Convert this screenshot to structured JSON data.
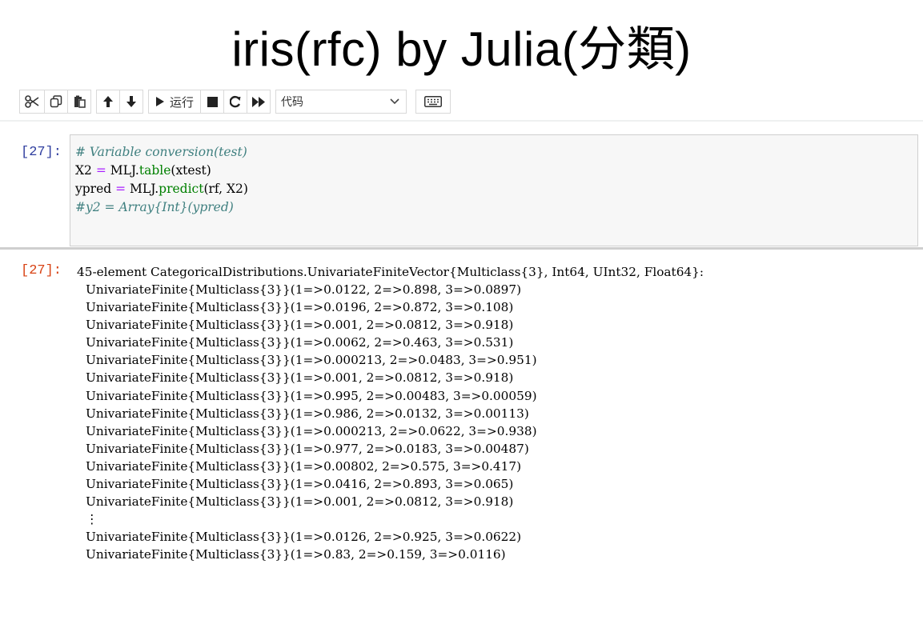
{
  "slide": {
    "title": "iris(rfc) by Julia(分類)"
  },
  "toolbar": {
    "run_label": "运行",
    "cell_type": "代码",
    "icons": [
      "cut-icon",
      "copy-icon",
      "paste-icon",
      "move-up-icon",
      "move-down-icon",
      "run-icon",
      "stop-icon",
      "restart-icon",
      "fast-forward-icon",
      "chevron-down-icon",
      "keyboard-icon"
    ]
  },
  "cell": {
    "in_prompt": "[27]:",
    "out_prompt": "[27]:",
    "code_lines": [
      "# Variable conversion(test)",
      "X2 = MLJ.table(xtest)",
      "ypred = MLJ.predict(rf, X2)",
      "#y2 = Array{Int}(ypred)"
    ]
  },
  "output": {
    "header": "45-element CategoricalDistributions.UnivariateFiniteVector{Multiclass{3}, Int64, UInt32, Float64}:",
    "rows": [
      "UnivariateFinite{Multiclass{3}}(1=>0.0122, 2=>0.898, 3=>0.0897)",
      "UnivariateFinite{Multiclass{3}}(1=>0.0196, 2=>0.872, 3=>0.108)",
      "UnivariateFinite{Multiclass{3}}(1=>0.001, 2=>0.0812, 3=>0.918)",
      "UnivariateFinite{Multiclass{3}}(1=>0.0062, 2=>0.463, 3=>0.531)",
      "UnivariateFinite{Multiclass{3}}(1=>0.000213, 2=>0.0483, 3=>0.951)",
      "UnivariateFinite{Multiclass{3}}(1=>0.001, 2=>0.0812, 3=>0.918)",
      "UnivariateFinite{Multiclass{3}}(1=>0.995, 2=>0.00483, 3=>0.00059)",
      "UnivariateFinite{Multiclass{3}}(1=>0.986, 2=>0.0132, 3=>0.00113)",
      "UnivariateFinite{Multiclass{3}}(1=>0.000213, 2=>0.0622, 3=>0.938)",
      "UnivariateFinite{Multiclass{3}}(1=>0.977, 2=>0.0183, 3=>0.00487)",
      "UnivariateFinite{Multiclass{3}}(1=>0.00802, 2=>0.575, 3=>0.417)",
      "UnivariateFinite{Multiclass{3}}(1=>0.0416, 2=>0.893, 3=>0.065)",
      "UnivariateFinite{Multiclass{3}}(1=>0.001, 2=>0.0812, 3=>0.918)",
      "⋮",
      "UnivariateFinite{Multiclass{3}}(1=>0.0126, 2=>0.925, 3=>0.0622)",
      "UnivariateFinite{Multiclass{3}}(1=>0.83, 2=>0.159, 3=>0.0116)"
    ]
  }
}
